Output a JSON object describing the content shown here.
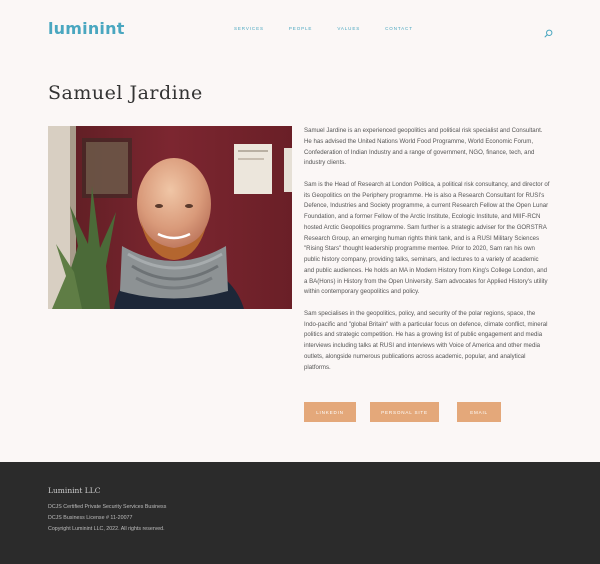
{
  "header": {
    "logo": "luminint",
    "nav": [
      "SERVICES",
      "PEOPLE",
      "VALUES",
      "CONTACT"
    ]
  },
  "profile": {
    "name": "Samuel Jardine",
    "bio": [
      "Samuel Jardine is an experienced geopolitics and political risk specialist and Consultant. He has advised the United Nations World Food Programme, World Economic Forum, Confederation of Indian Industry and a range of government, NGO, finance, tech, and industry clients.",
      "Sam is the Head of Research at London Politica, a political risk consultancy, and director of its Geopolitics on the Periphery programme. He is also a Research Consultant for RUSI's Defence, Industries and Society programme, a current Research Fellow at the Open Lunar Foundation, and a former Fellow of the Arctic Institute, Ecologic Institute, and MIIF-RCN hosted Arctic Geopolitics programme. Sam further is a strategic adviser for the GORSTRA Research Group, an emerging human rights think tank, and is a RUSI Military Sciences \"Rising Stars\" thought leadership programme mentee. Prior to 2020, Sam ran his own public history company, providing talks, seminars, and lectures to a variety of academic and public audiences. He holds an MA in Modern History from King's College London, and a BA(Hons) in History from the Open University. Sam advocates for Applied History's utility within contemporary geopolitics and policy.",
      "Sam specialises in the geopolitics, policy, and security of the polar regions, space, the Indo-pacific and \"global Britain\" with a particular focus on defence, climate conflict, mineral politics and strategic competition. He has a growing list of public engagement and media interviews including talks at RUSI and interviews with Voice of America and other media outlets, alongside numerous publications across academic, popular, and analytical platforms."
    ],
    "buttons": {
      "linkedin": "LINKEDIN",
      "personal_site": "PERSONAL SITE",
      "email": "EMAIL"
    }
  },
  "footer": {
    "brand": "Luminint LLC",
    "lines": [
      "DCJS Certified Private Security Services Business",
      "DCJS Business License # 11-20077",
      "Copyright Luminint LLC, 2022.  All rights reserved."
    ]
  },
  "colors": {
    "accent": "#4aa7c0",
    "button": "#e4a87a",
    "background": "#fbf7f6",
    "footer": "#2b2b2b"
  },
  "icons": {
    "search": "search-icon"
  }
}
